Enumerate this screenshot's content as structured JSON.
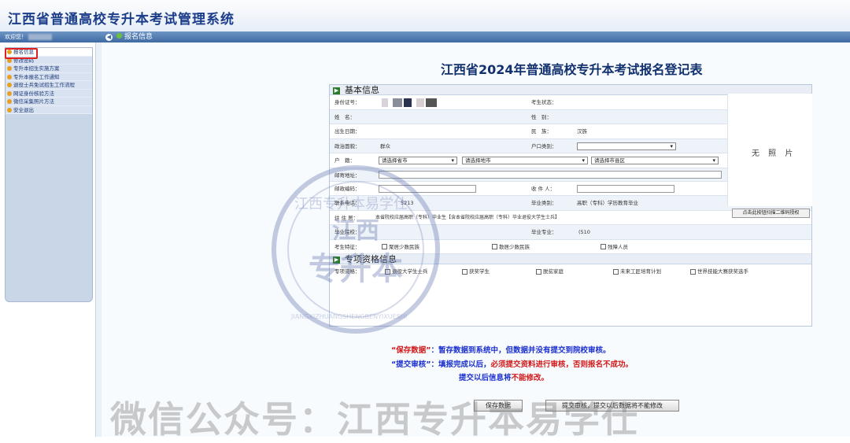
{
  "app": {
    "title": "江西省普通高校专升本考试管理系统"
  },
  "nav": {
    "welcome": "欢迎您！",
    "breadcrumb": "报名信息"
  },
  "sidebar": {
    "items": [
      {
        "label": "报名信息"
      },
      {
        "label": "修改密码"
      },
      {
        "label": "专升本招生实施方案"
      },
      {
        "label": "专升本报名工作通知"
      },
      {
        "label": "退役士兵免试招生工作流程"
      },
      {
        "label": "网证身份核验方法"
      },
      {
        "label": "微信采集照片方法"
      },
      {
        "label": "安全退出"
      }
    ]
  },
  "form": {
    "title": "江西省2024年普通高校专升本考试报名登记表",
    "section_basic": "基本信息",
    "section_special": "专项资格信息",
    "photo_text": "无 照 片",
    "fields": {
      "id_label": "身份证号：",
      "status_label": "考生状态：",
      "name_label": "姓　名：",
      "gender_label": "性　别：",
      "birth_label": "出生日期：",
      "ethnic_label": "民　族：",
      "ethnic_value": "汉族",
      "political_label": "政治面貌：",
      "political_value": "群众",
      "hukou_label": "户口类别：",
      "native_label": "户　籍：",
      "native_select1": "请选择省市",
      "native_select2": "请选择地市",
      "native_select3": "请选择市县区",
      "mail_addr_label": "邮寄地址：",
      "postcode_label": "邮政编码：",
      "receiver_label": "收 件 人：",
      "qr_button": "点击此按钮扫描二维码授权",
      "phone_label": "联系电话：",
      "phone_value": "5213",
      "grad_type_label": "毕业类别：",
      "grad_type_value": "高职（专科）学历教育毕业",
      "residence_label": "住 住 居：",
      "residence_value": "本省院校应届高职（专科）毕业生【含本省院校应届高职（专科）毕业退役大学生士兵】",
      "school_label": "毕业院校：",
      "major_label": "毕业专业：",
      "major_value": "(510",
      "special_label": "考生特征：",
      "special_opts": [
        "聚居少数民族",
        "散居少数民族",
        "残障人员"
      ],
      "qualification_label": "专项资格：",
      "qualification_opts": [
        "退役大学生士兵",
        "获奖学生",
        "脱贫家庭",
        "未来工匠培育计划",
        "世界技能大赛获奖选手"
      ]
    }
  },
  "notice": {
    "save_title": "“保存数据”",
    "save_text": "：暂存数据到系统中，但数据并没有提交到院校审核。",
    "submit_title": "“提交审核”",
    "submit_text_a": "：填报完成以后，",
    "submit_text_b": "必须提交资料进行审核，否则报名不成功。",
    "line3_a": "提交以后信息将",
    "line3_b": "不能修改。"
  },
  "buttons": {
    "save": "保存数据",
    "submit": "提交审核，提交以后数据将不能修改"
  },
  "watermark": {
    "text": "微信公众号：江西专升本易学仕",
    "seal_outer": "江西专升本易学仕",
    "seal_latin": "JIANGXIZHUANGSHENGBENYIXUESHI",
    "seal_center_top": "江西",
    "seal_center_bottom": "专升本"
  },
  "colors": {
    "title_blue": "#1b3d8a",
    "nav_blue": "#3f6aa3",
    "notice_blue": "#1a2fd0",
    "notice_red": "#d01818",
    "selection_red": "#e02020"
  }
}
